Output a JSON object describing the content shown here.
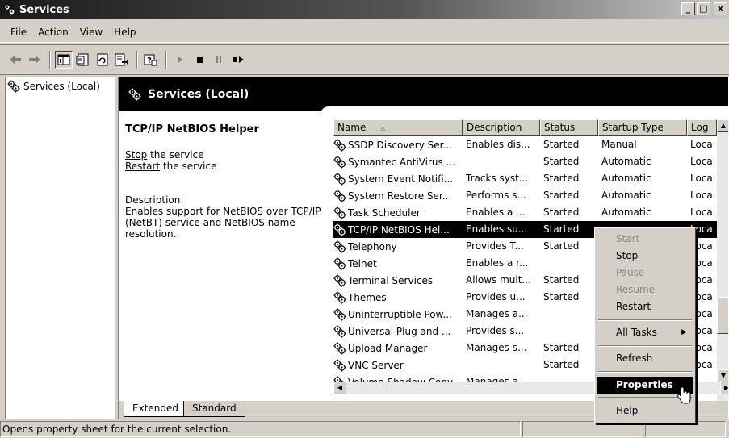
{
  "window": {
    "title": "Services",
    "min": "_",
    "max": "□",
    "close": "x"
  },
  "menu": [
    "File",
    "Action",
    "View",
    "Help"
  ],
  "toolbar": [
    "back-icon",
    "forward-icon",
    "show-hide-tree-icon",
    "properties-icon",
    "refresh-icon",
    "export-list-icon",
    "help-icon",
    "start-service-icon",
    "stop-service-icon",
    "pause-service-icon",
    "restart-service-icon"
  ],
  "tree": {
    "root": "Services (Local)"
  },
  "header": {
    "title": "Services (Local)"
  },
  "detail": {
    "service_name": "TCP/IP NetBIOS Helper",
    "stop_link": "Stop",
    "stop_suffix": " the service",
    "restart_link": "Restart",
    "restart_suffix": " the service",
    "desc_label": "Description:",
    "desc_text": "Enables support for NetBIOS over TCP/IP (NetBT) service and NetBIOS name resolution."
  },
  "list": {
    "columns": [
      "Name",
      "Description",
      "Status",
      "Startup Type",
      "Log"
    ],
    "rows": [
      {
        "name": "SSDP Discovery Ser...",
        "desc": "Enables dis...",
        "status": "Started",
        "startup": "Manual",
        "log": "Loca"
      },
      {
        "name": "Symantec AntiVirus ...",
        "desc": "",
        "status": "Started",
        "startup": "Automatic",
        "log": "Loca"
      },
      {
        "name": "System Event Notifi...",
        "desc": "Tracks syst...",
        "status": "Started",
        "startup": "Automatic",
        "log": "Loca"
      },
      {
        "name": "System Restore Ser...",
        "desc": "Performs s...",
        "status": "Started",
        "startup": "Automatic",
        "log": "Loca"
      },
      {
        "name": "Task Scheduler",
        "desc": "Enables a ...",
        "status": "Started",
        "startup": "Automatic",
        "log": "Loca"
      },
      {
        "name": "TCP/IP NetBIOS Hel...",
        "desc": "Enables su...",
        "status": "Started",
        "startup": "",
        "log": "Loca"
      },
      {
        "name": "Telephony",
        "desc": "Provides T...",
        "status": "Started",
        "startup": "",
        "log": "Loca"
      },
      {
        "name": "Telnet",
        "desc": "Enables a r...",
        "status": "",
        "startup": "",
        "log": "Loca"
      },
      {
        "name": "Terminal Services",
        "desc": "Allows mult...",
        "status": "Started",
        "startup": "",
        "log": "Loca"
      },
      {
        "name": "Themes",
        "desc": "Provides u...",
        "status": "Started",
        "startup": "",
        "log": "Loca"
      },
      {
        "name": "Uninterruptible Pow...",
        "desc": "Manages a...",
        "status": "",
        "startup": "",
        "log": "Loca"
      },
      {
        "name": "Universal Plug and ...",
        "desc": "Provides s...",
        "status": "",
        "startup": "",
        "log": "Loca"
      },
      {
        "name": "Upload Manager",
        "desc": "Manages s...",
        "status": "Started",
        "startup": "",
        "log": "Loca"
      },
      {
        "name": "VNC Server",
        "desc": "",
        "status": "Started",
        "startup": "",
        "log": "Loca"
      },
      {
        "name": "Volume Shadow Copy",
        "desc": "Manages a...",
        "status": "",
        "startup": "",
        "log": ""
      }
    ]
  },
  "tabs": {
    "extended": "Extended",
    "standard": "Standard"
  },
  "context_menu": {
    "start": "Start",
    "stop": "Stop",
    "pause": "Pause",
    "resume": "Resume",
    "restart": "Restart",
    "all_tasks": "All Tasks",
    "refresh": "Refresh",
    "properties": "Properties",
    "help": "Help"
  },
  "status": {
    "text": "Opens property sheet for the current selection."
  }
}
